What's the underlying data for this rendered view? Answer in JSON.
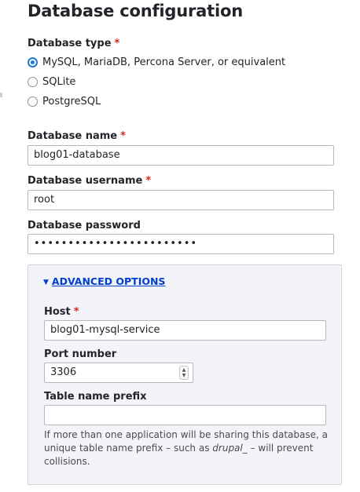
{
  "title": "Database configuration",
  "db_type": {
    "label": "Database type",
    "required_mark": "*",
    "options": [
      {
        "label": "MySQL, MariaDB, Percona Server, or equivalent",
        "checked": true
      },
      {
        "label": "SQLite",
        "checked": false
      },
      {
        "label": "PostgreSQL",
        "checked": false
      }
    ]
  },
  "db_name": {
    "label": "Database name",
    "required_mark": "*",
    "value": "blog01-database"
  },
  "db_username": {
    "label": "Database username",
    "required_mark": "*",
    "value": "root"
  },
  "db_password": {
    "label": "Database password",
    "masked_value": "••••••••••••••••••••••••"
  },
  "advanced": {
    "toggle_label": "ADVANCED OPTIONS",
    "expanded": true,
    "host": {
      "label": "Host",
      "required_mark": "*",
      "value": "blog01-mysql-service"
    },
    "port": {
      "label": "Port number",
      "value": "3306"
    },
    "prefix": {
      "label": "Table name prefix",
      "value": "",
      "description_before": "If more than one application will be sharing this database, a unique table name prefix – such as ",
      "description_em": "drupal_",
      "description_after": " – will prevent collisions."
    }
  },
  "colors": {
    "required": "#dc2323",
    "link": "#003ecc",
    "radio_checked": "#1e7ad6",
    "details_background": "#f3f4f9"
  }
}
